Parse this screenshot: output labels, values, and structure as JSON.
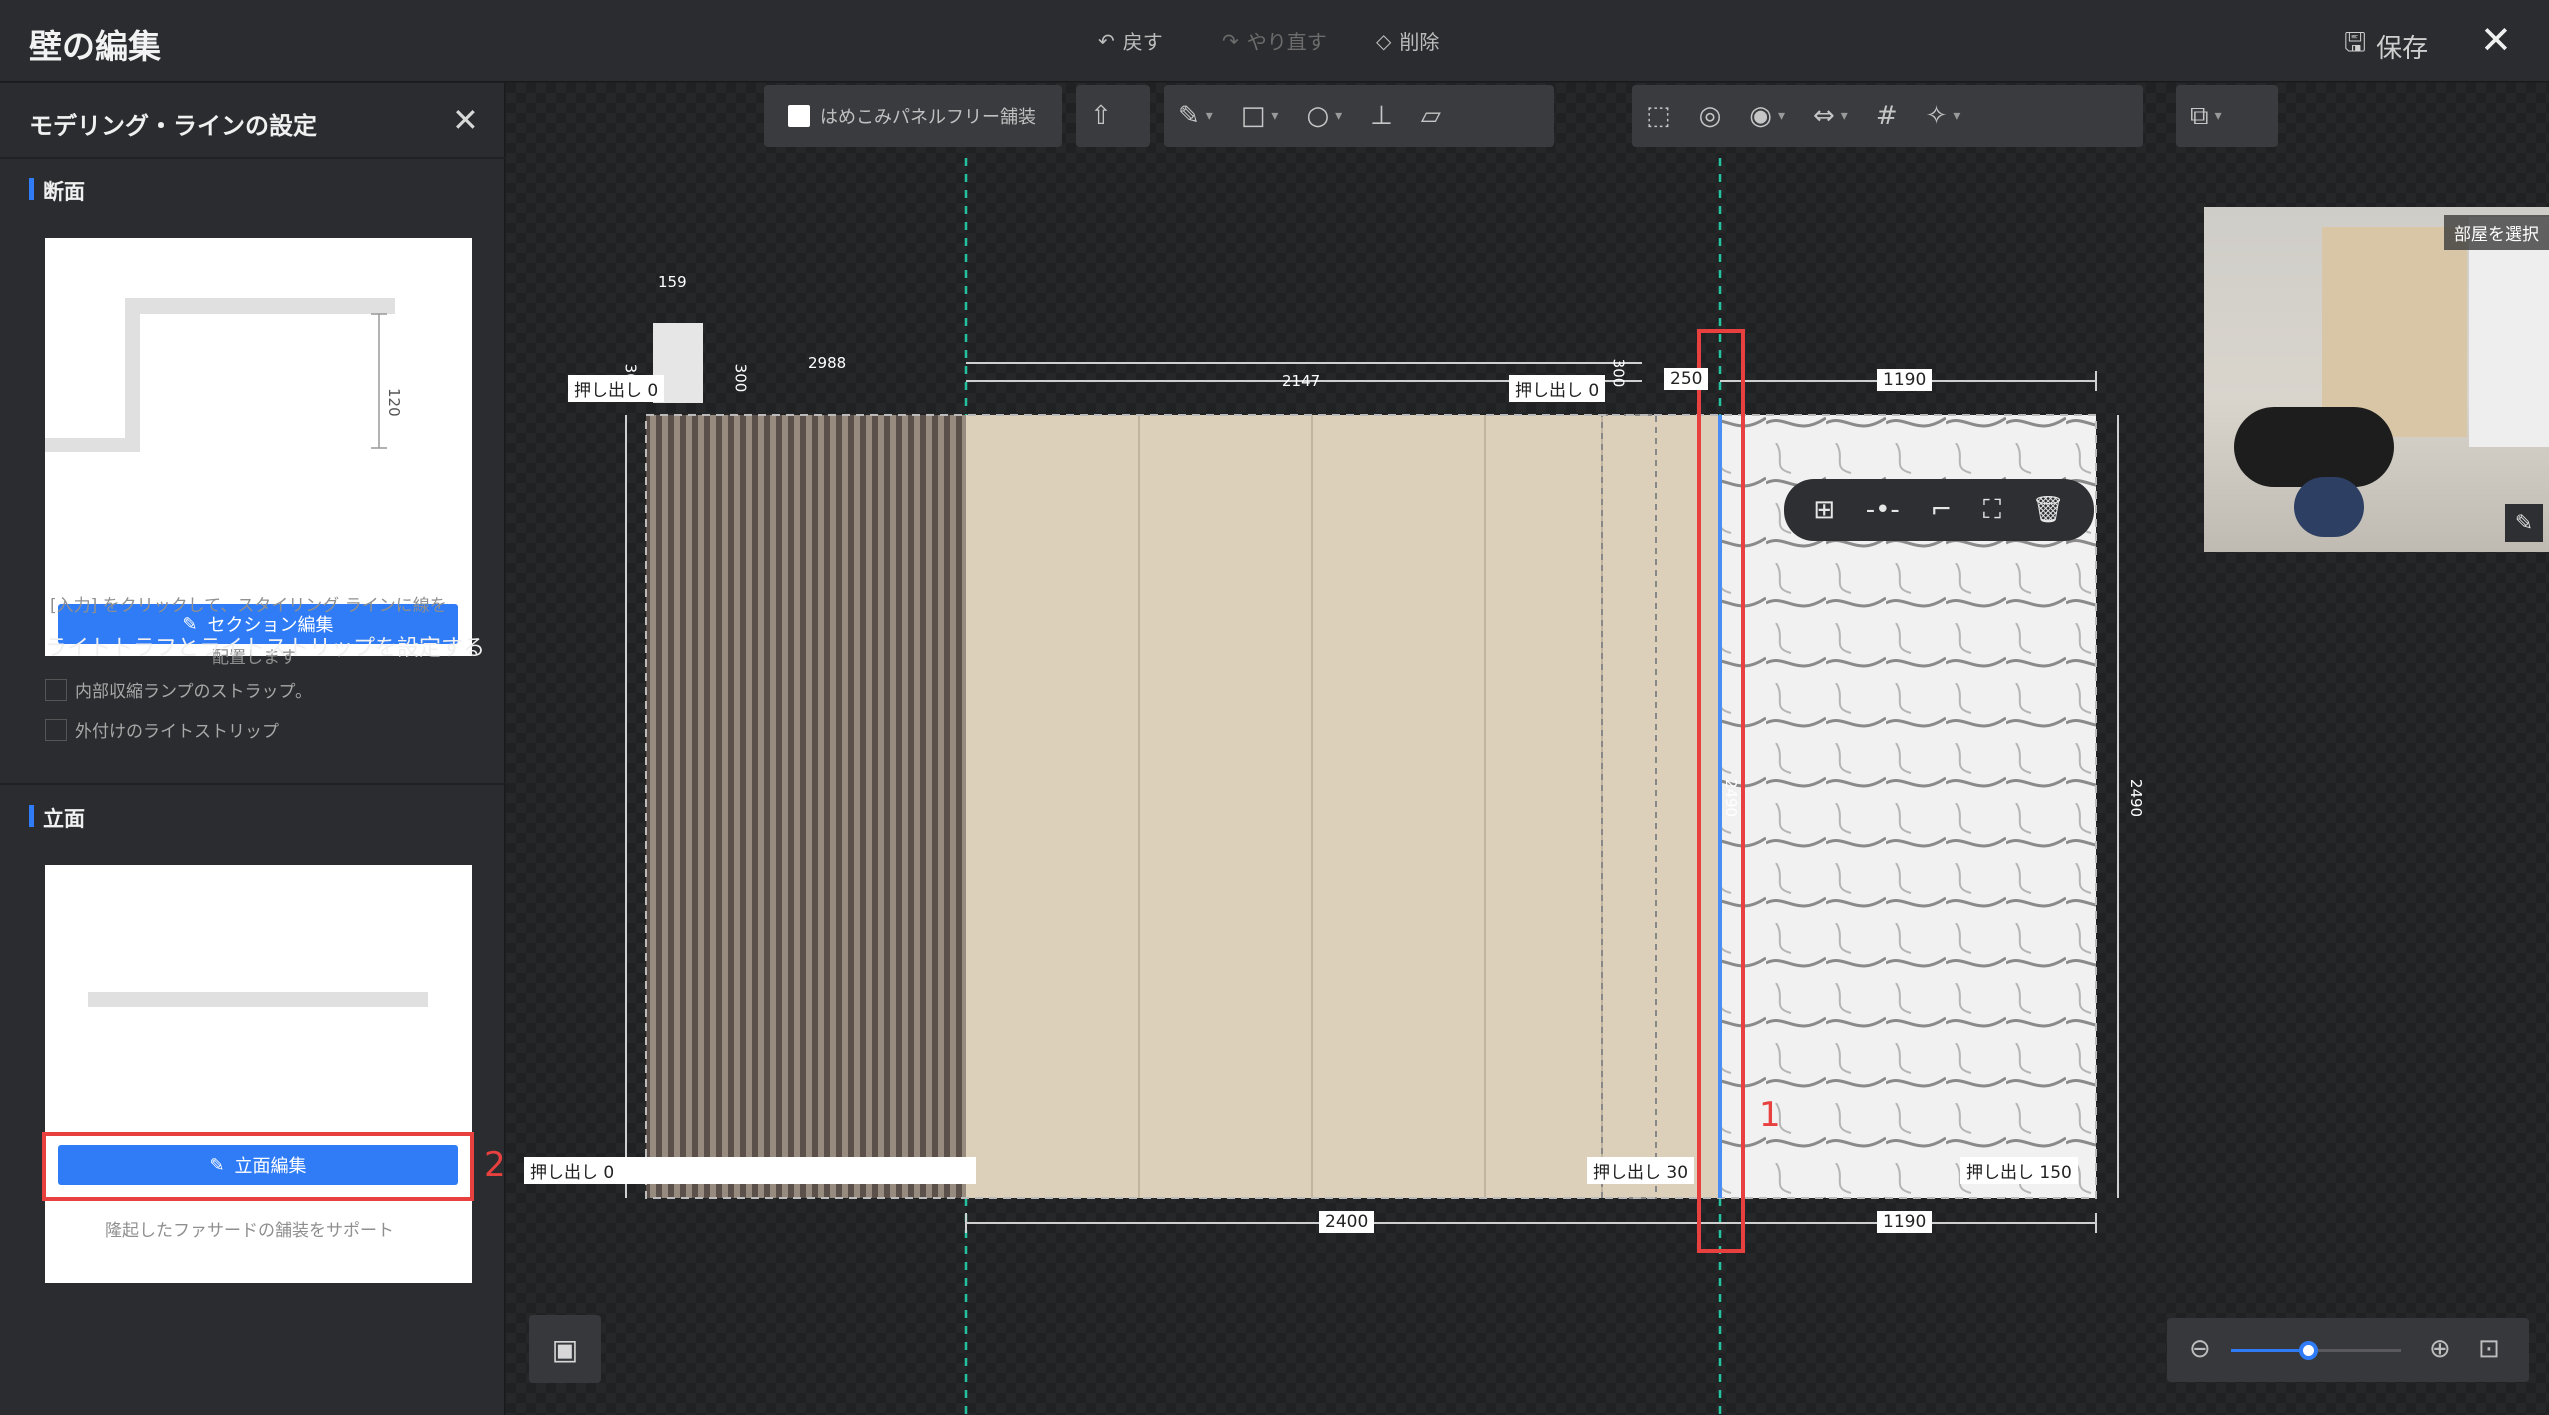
{
  "header": {
    "title": "壁の編集",
    "undo_label": "戻す",
    "redo_label": "やり直す",
    "delete_label": "削除",
    "save_label": "保存"
  },
  "sidebar": {
    "panel_title": "モデリング・ラインの設定",
    "section_label": "断面",
    "section_edit_label": "セクション編集",
    "section_dimension": "120",
    "hint_input": "[入力] をクリックして、スタイリング ラインに線を",
    "hint_input_2": "配置します",
    "light_title": "ライトトラフとライトストリップを設定する",
    "check_inner_strap": "内部収縮ランプのストラップ。",
    "check_outer_strip": "外付けのライトストリップ",
    "elevation_label": "立面",
    "elevation_edit_label": "立面編集",
    "elevation_hint": "隆起したファサードの舗装をサポート",
    "annotation_2": "2"
  },
  "toolbar": {
    "inset_panel_free_label": "はめこみパネルフリー舗装"
  },
  "canvas": {
    "dim_top_small": "159",
    "dim_2988": "2988",
    "dim_2147": "2147",
    "dim_250": "250",
    "dim_1190_top": "1190",
    "dim_2400": "2400",
    "dim_1190_bottom": "1190",
    "dim_height": "2490",
    "dim_height_mid": "2490",
    "dim_300_a": "300",
    "dim_300_b": "300",
    "dim_300_c": "300",
    "extrude_0_top_left": "押し出し 0",
    "extrude_0_top_mid": "押し出し 0",
    "extrude_0_bottom_left": "押し出し 0",
    "extrude_30": "押し出し 30",
    "extrude_150": "押し出し 150",
    "annotation_1": "1",
    "preview_room_button": "部屋を選択"
  },
  "zoom": {
    "level": 0.45
  },
  "colors": {
    "accent": "#2f7cf6",
    "annotation": "#e8403e",
    "wood": "#ddd0bb",
    "guide": "#22c3a0"
  }
}
